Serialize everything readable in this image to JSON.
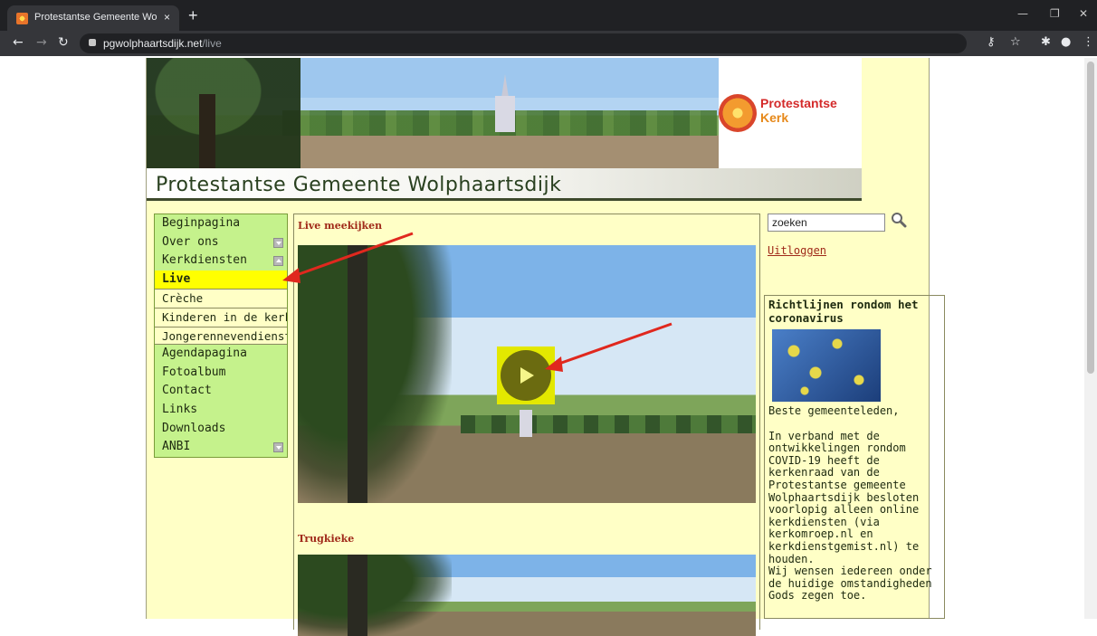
{
  "browser": {
    "tab_title": "Protestantse Gemeente Wolphaa",
    "tab_close": "×",
    "new_tab": "+",
    "url_domain": "pgwolphaartsdijk.net",
    "url_path": "/live"
  },
  "site": {
    "title": "Protestantse Gemeente Wolphaartsdijk",
    "logo_line1": "Protestantse",
    "logo_line2": "Kerk"
  },
  "nav": {
    "items": [
      {
        "label": "Beginpagina"
      },
      {
        "label": "Over ons"
      },
      {
        "label": "Kerkdiensten"
      },
      {
        "label": "Live"
      },
      {
        "label": "Crèche"
      },
      {
        "label": "Kinderen in de kerk"
      },
      {
        "label": "Jongerennevendienst"
      },
      {
        "label": "Agendapagina"
      },
      {
        "label": "Fotoalbum"
      },
      {
        "label": "Contact"
      },
      {
        "label": "Links"
      },
      {
        "label": "Downloads"
      },
      {
        "label": "ANBI"
      }
    ]
  },
  "main": {
    "live_title": "Live meekijken",
    "replay_title": "Trugkieke"
  },
  "sidebar_right": {
    "search_value": "zoeken",
    "logout": "Uitloggen",
    "news_title": "Richtlijnen rondom het coronavirus",
    "news_greeting": "Beste gemeenteleden,",
    "news_body": "In verband met de ontwikkelingen rondom COVID-19 heeft de kerkenraad van de Protestantse gemeente Wolphaartsdijk besloten voorlopig alleen online kerkdiensten (via kerkomroep.nl en kerkdienstgemist.nl) te houden.",
    "news_body2": "Wij wensen iedereen onder de huidige omstandigheden Gods zegen toe."
  },
  "colors": {
    "page_bg": "#ffffc6",
    "nav_bg": "#c5f28c",
    "active_bg": "#ffff00",
    "heading_red": "#a02a1a",
    "annotation_arrow": "#e0281e"
  },
  "icons": [
    "back-icon",
    "forward-icon",
    "reload-icon",
    "lock-icon",
    "key-icon",
    "star-icon",
    "extensions-icon",
    "profile-icon",
    "menu-icon",
    "search-icon",
    "play-icon"
  ]
}
